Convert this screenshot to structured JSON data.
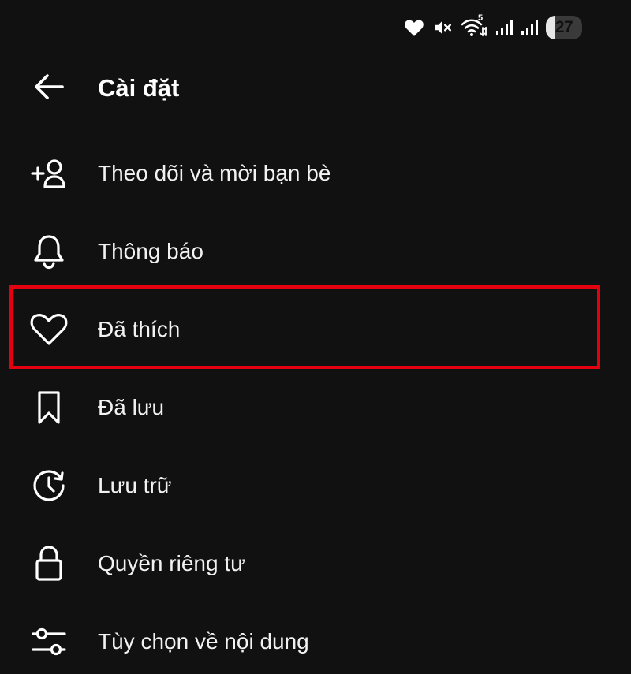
{
  "status_bar": {
    "icons": [
      "heart-icon",
      "mute-icon",
      "wifi-icon",
      "signal-icon",
      "signal-icon"
    ],
    "wifi_badge": "5",
    "battery_level": "27",
    "battery_fraction": 0.27
  },
  "header": {
    "back_icon": "arrow-left-icon",
    "title": "Cài đặt"
  },
  "menu": {
    "items": [
      {
        "label": "Theo dõi và mời bạn bè",
        "icon": "add-person-icon"
      },
      {
        "label": "Thông báo",
        "icon": "bell-icon"
      },
      {
        "label": "Đã thích",
        "icon": "heart-outline-icon"
      },
      {
        "label": "Đã lưu",
        "icon": "bookmark-icon"
      },
      {
        "label": "Lưu trữ",
        "icon": "archive-clock-icon"
      },
      {
        "label": "Quyền riêng tư",
        "icon": "lock-icon"
      },
      {
        "label": "Tùy chọn về nội dung",
        "icon": "sliders-icon"
      }
    ],
    "highlighted_index": 2
  },
  "colors": {
    "background": "#111111",
    "text": "#ffffff",
    "highlight": "#e3000f"
  }
}
